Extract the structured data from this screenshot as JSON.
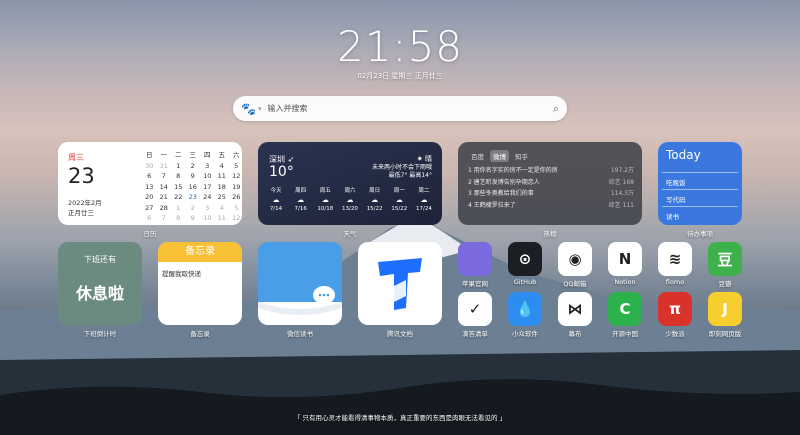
{
  "clock": {
    "time": "21:58",
    "date": "02月23日 星期三 正月廿三"
  },
  "search": {
    "placeholder": "输入并搜索"
  },
  "calendar": {
    "weekday": "周三",
    "day": "23",
    "year_month": "2022年2月",
    "lunar": "正月廿三",
    "label": "日历",
    "headers": [
      "日",
      "一",
      "二",
      "三",
      "四",
      "五",
      "六"
    ],
    "days": [
      "30",
      "31",
      "1",
      "2",
      "3",
      "4",
      "5",
      "6",
      "7",
      "8",
      "9",
      "10",
      "11",
      "12",
      "13",
      "14",
      "15",
      "16",
      "17",
      "18",
      "19",
      "20",
      "21",
      "22",
      "23",
      "24",
      "25",
      "26",
      "27",
      "28",
      "1",
      "2",
      "3",
      "4",
      "5",
      "6",
      "7",
      "8",
      "9",
      "10",
      "11",
      "12"
    ],
    "today": "23"
  },
  "weather": {
    "city": "深圳",
    "temp": "10°",
    "condition": "晴",
    "forecast": "未来两小时不会下雨哦",
    "range": "最低7° 最高14°",
    "label": "天气",
    "days": [
      {
        "name": "今天",
        "icon": "☁",
        "temp": "7/14"
      },
      {
        "name": "周四",
        "icon": "☁",
        "temp": "7/16"
      },
      {
        "name": "周五",
        "icon": "☁",
        "temp": "10/18"
      },
      {
        "name": "周六",
        "icon": "☁",
        "temp": "13/20"
      },
      {
        "name": "周日",
        "icon": "☁",
        "temp": "15/22"
      },
      {
        "name": "周一",
        "icon": "☁",
        "temp": "15/22"
      },
      {
        "name": "周二",
        "icon": "☁",
        "temp": "17/24"
      }
    ]
  },
  "hotlist": {
    "tabs": [
      "百度",
      "微博",
      "知乎"
    ],
    "active_tab": "微博",
    "label": "热榜",
    "items": [
      {
        "rank": "1",
        "title": "用你名字实的房不一定是你的房",
        "value": "197.2万"
      },
      {
        "rank": "2",
        "title": "唐艺昕发博告别孕期恋人",
        "value": "综艺 168"
      },
      {
        "rank": "3",
        "title": "那些冬奥教给我们的事",
        "value": "114.3万"
      },
      {
        "rank": "4",
        "title": "王鹤棣罗拉来了",
        "value": "综艺 111"
      }
    ]
  },
  "todo": {
    "title": "Today",
    "items": [
      "吃晚饭",
      "写代码",
      "读书"
    ],
    "label": "待办事项"
  },
  "countdown": {
    "line1": "下班还有",
    "line2": "休息啦",
    "label": "下班倒计时"
  },
  "memo": {
    "header": "备忘录",
    "body": "提醒我取快递",
    "label": "备忘录"
  },
  "weread": {
    "label": "微信读书"
  },
  "txdoc": {
    "label": "腾讯文档"
  },
  "apps": [
    {
      "name": "苹果官网",
      "color": "#7b6ae0",
      "glyph": "",
      "icon": "apple-icon"
    },
    {
      "name": "GitHub",
      "color": "#1b1f23",
      "glyph": "⊙",
      "icon": "github-icon"
    },
    {
      "name": "QQ邮箱",
      "color": "#ffffff",
      "glyph": "◉",
      "icon": "qqmail-icon"
    },
    {
      "name": "Notion",
      "color": "#ffffff",
      "glyph": "N",
      "icon": "notion-icon"
    },
    {
      "name": "flomo",
      "color": "#ffffff",
      "glyph": "≋",
      "icon": "flomo-icon"
    },
    {
      "name": "豆瓣",
      "color": "#3fb14a",
      "glyph": "豆",
      "icon": "douban-icon"
    },
    {
      "name": "滴答清单",
      "color": "#ffffff",
      "glyph": "✓",
      "icon": "ticktick-icon"
    },
    {
      "name": "小众软件",
      "color": "#2d8cf0",
      "glyph": "💧",
      "icon": "appinn-icon"
    },
    {
      "name": "幕布",
      "color": "#ffffff",
      "glyph": "⋈",
      "icon": "mubu-icon"
    },
    {
      "name": "开源中国",
      "color": "#2bb24c",
      "glyph": "C",
      "icon": "oschina-icon"
    },
    {
      "name": "少数派",
      "color": "#d9322b",
      "glyph": "π",
      "icon": "sspai-icon"
    },
    {
      "name": "即刻网页版",
      "color": "#f6cf2f",
      "glyph": "J",
      "icon": "jike-icon"
    }
  ],
  "quote": "「 只有用心灵才能看得清事物本质，真正重要的东西是肉眼无法看见的 」"
}
